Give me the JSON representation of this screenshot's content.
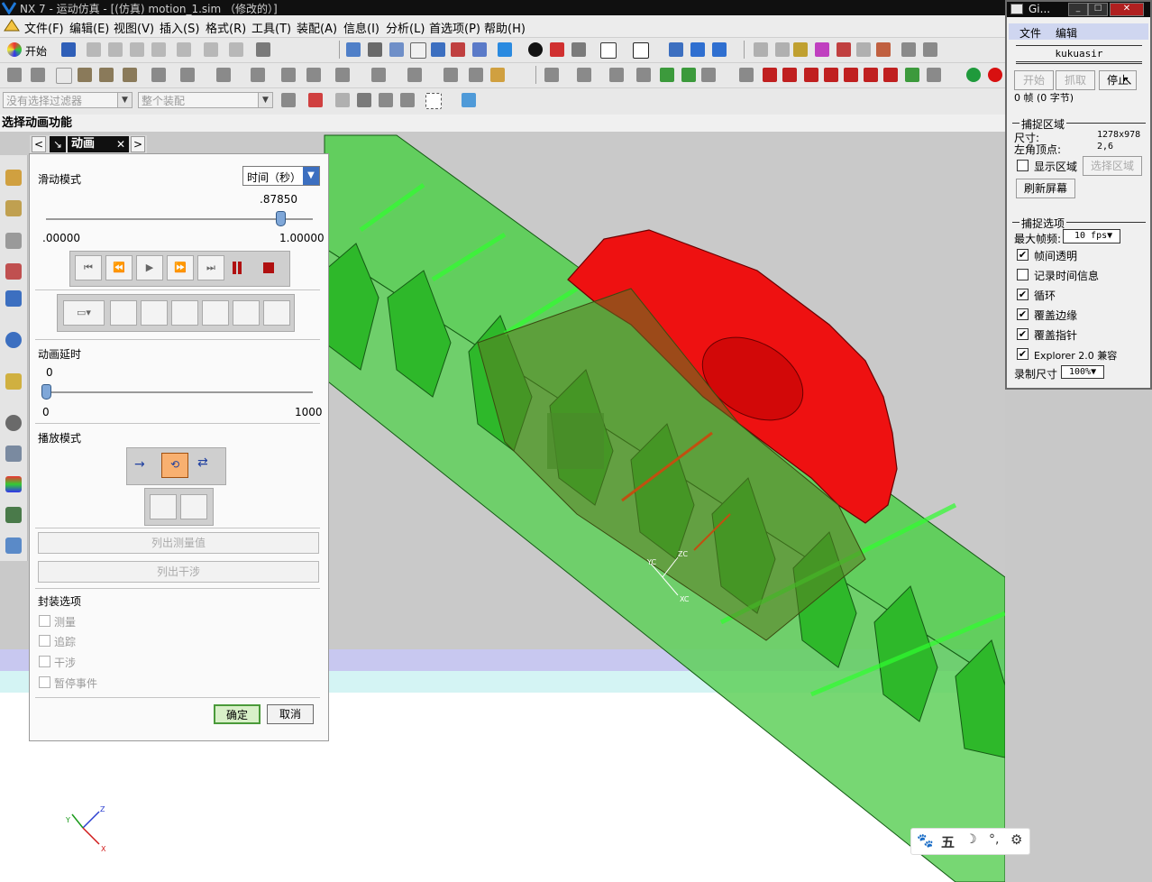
{
  "app": {
    "title": "NX 7 - 运动仿真 - [(仿真) motion_1.sim （修改的）]",
    "menu": [
      "文件(F)",
      "编辑(E)",
      "视图(V)",
      "插入(S)",
      "格式(R)",
      "工具(T)",
      "装配(A)",
      "信息(I)",
      "分析(L)",
      "首选项(P)",
      "帮助(H)"
    ],
    "start_label": "开始",
    "filter_placeholder": "没有选择过滤器",
    "assembly_scope": "整个装配",
    "prompt": "选择动画功能"
  },
  "dialog": {
    "tab_label": "动画",
    "slide_mode_label": "滑动模式",
    "slide_mode_value": "时间（秒）",
    "time_value_text": ".87850",
    "time_value": 0.8785,
    "time_min": ".00000",
    "time_max": "1.00000",
    "delay_label": "动画延时",
    "delay_value": "0",
    "delay_min": "0",
    "delay_max": "1000",
    "play_mode_label": "播放模式",
    "list_measure_button": "列出测量值",
    "list_interference_button": "列出干涉",
    "envelope_label": "封装选项",
    "envelope_options": [
      "测量",
      "追踪",
      "干涉",
      "暂停事件"
    ],
    "ok_button": "确定",
    "cancel_button": "取消"
  },
  "capture": {
    "title": "Gi...",
    "menu": [
      "文件",
      "编辑"
    ],
    "user": "kukuasir",
    "start_button": "开始",
    "grab_button": "抓取",
    "stop_button": "停止",
    "frames_text": "0 帧 (0 字节)",
    "region_header": "捕捉区域",
    "size_label": "尺寸:",
    "size_value": "1278x978",
    "corner_label": "左角顶点:",
    "corner_value": "2,6",
    "show_region_label": "显示区域",
    "select_region_button": "选择区域",
    "refresh_button": "刷新屏幕",
    "options_header": "捕捉选项",
    "max_fps_label": "最大帧频:",
    "max_fps_value": "10 fps",
    "options": [
      {
        "label": "帧间透明",
        "checked": true
      },
      {
        "label": "记录时间信息",
        "checked": false
      },
      {
        "label": "循环",
        "checked": true
      },
      {
        "label": "覆盖边缘",
        "checked": true
      },
      {
        "label": "覆盖指针",
        "checked": true
      },
      {
        "label": "Explorer 2.0 兼容",
        "checked": true
      }
    ],
    "record_size_label": "录制尺寸",
    "record_size_value": "100%"
  },
  "viewport": {
    "rack_color": "#3fcf3a",
    "gear_color": "#ee1111",
    "triad_labels": [
      "YC",
      "ZC",
      "XC"
    ],
    "corner_triad_labels": [
      "Z",
      "Y",
      "X"
    ]
  },
  "ime": {
    "label": "五"
  }
}
